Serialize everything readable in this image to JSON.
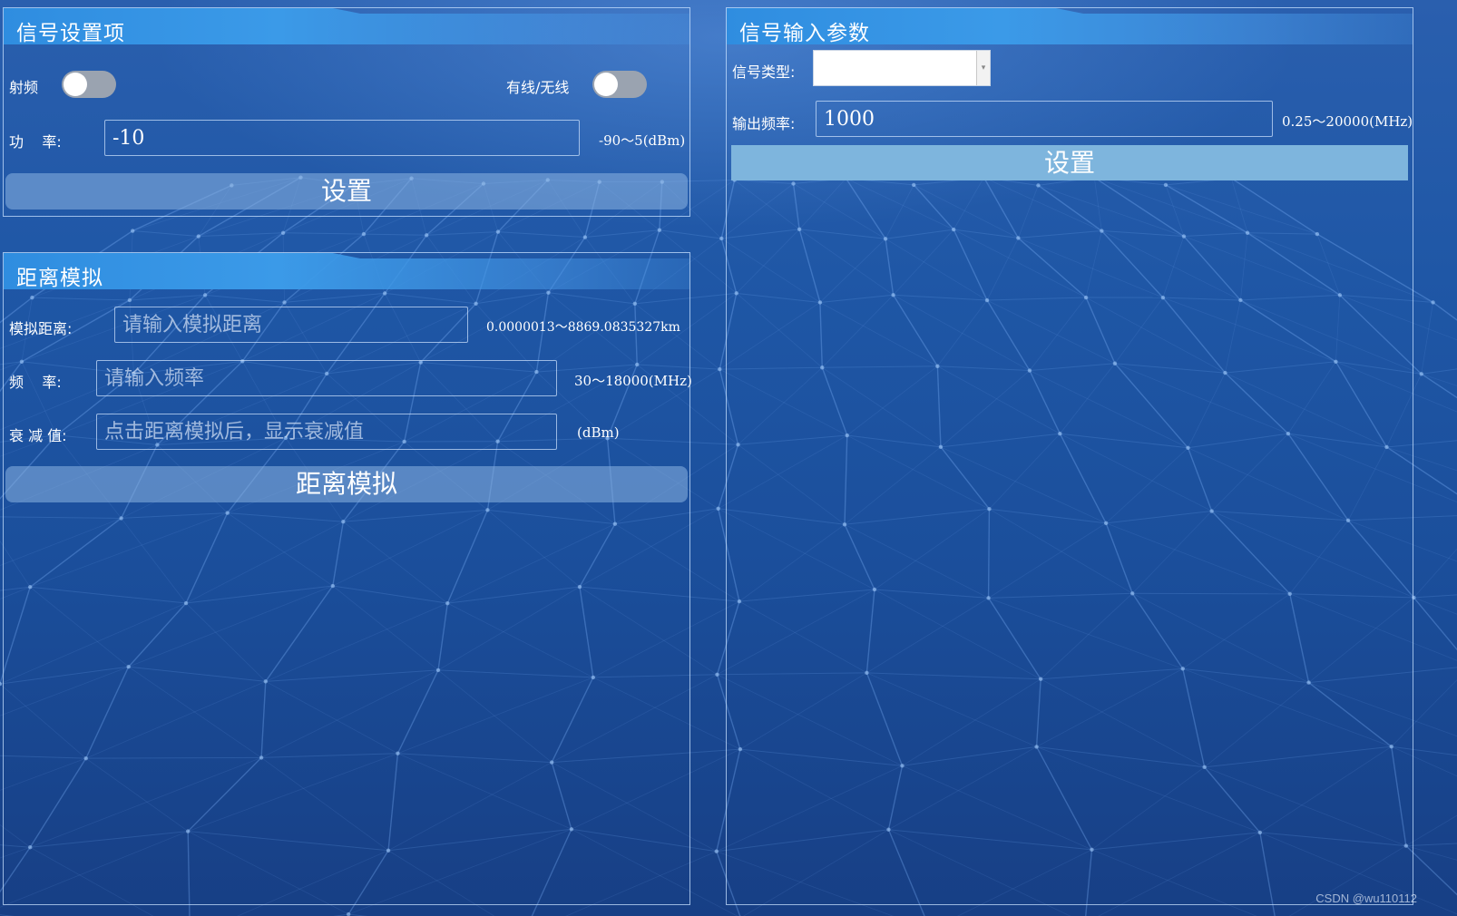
{
  "left_top_panel": {
    "title": "信号设置项",
    "rf_label": "射频",
    "rf_on": false,
    "wired_label": "有线/无线",
    "wired_on": false,
    "power_label": "功    率:",
    "power_value": "-10",
    "power_range": "-90～5(dBm)",
    "set_button": "设置"
  },
  "left_bottom_panel": {
    "title": "距离模拟",
    "distance_label": "模拟距离:",
    "distance_placeholder": "请输入模拟距离",
    "distance_range": "0.0000013～8869.0835327km",
    "freq_label": "频    率:",
    "freq_placeholder": "请输入频率",
    "freq_range": "30～18000(MHz)",
    "atten_label": "衰 减 值:",
    "atten_placeholder": "点击距离模拟后，显示衰减值",
    "atten_unit": "(dBm)",
    "simulate_button": "距离模拟"
  },
  "right_panel": {
    "title": "信号输入参数",
    "type_label": "信号类型:",
    "type_value": "",
    "output_freq_label": "输出频率:",
    "output_freq_value": "1000",
    "output_freq_range": "0.25～20000(MHz)",
    "set_button": "设置"
  },
  "watermark": "CSDN @wu110112",
  "colors": {
    "background": "#1f57a6",
    "header": "#3b9ae8",
    "button": "#7eb5dd",
    "toggle_off": "#9aa3b0"
  }
}
